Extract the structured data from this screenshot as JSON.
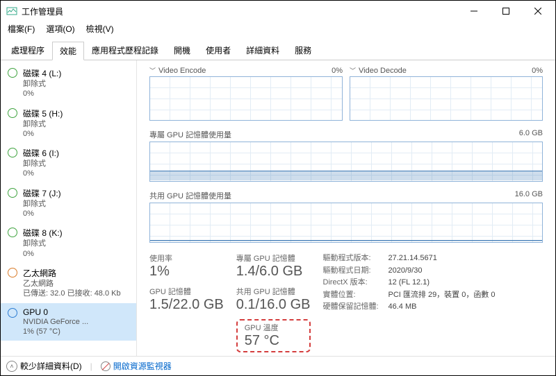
{
  "window": {
    "title": "工作管理員"
  },
  "menu": {
    "file": "檔案(F)",
    "options": "選項(O)",
    "view": "檢視(V)"
  },
  "tabs": {
    "processes": "處理程序",
    "performance": "效能",
    "app_history": "應用程式歷程記錄",
    "startup": "開機",
    "users": "使用者",
    "details": "詳細資料",
    "services": "服務"
  },
  "sidebar": [
    {
      "name": "磁碟 4 (L:)",
      "sub1": "卸除式",
      "sub2": "0%"
    },
    {
      "name": "磁碟 5 (H:)",
      "sub1": "卸除式",
      "sub2": "0%"
    },
    {
      "name": "磁碟 6 (I:)",
      "sub1": "卸除式",
      "sub2": "0%"
    },
    {
      "name": "磁碟 7 (J:)",
      "sub1": "卸除式",
      "sub2": "0%"
    },
    {
      "name": "磁碟 8 (K:)",
      "sub1": "卸除式",
      "sub2": "0%"
    },
    {
      "name": "乙太網路",
      "sub1": "乙太網路",
      "sub2": "已傳送: 32.0  已接收: 48.0 Kb"
    },
    {
      "name": "GPU 0",
      "sub1": "NVIDIA GeForce ...",
      "sub2": "1%  (57 °C)"
    }
  ],
  "charts": {
    "video_encode": {
      "title": "Video Encode",
      "pct": "0%"
    },
    "video_decode": {
      "title": "Video Decode",
      "pct": "0%"
    },
    "dedicated_mem": {
      "title": "專屬 GPU 記憶體使用量",
      "max": "6.0 GB"
    },
    "shared_mem": {
      "title": "共用 GPU 記憶體使用量",
      "max": "16.0 GB"
    }
  },
  "stats": {
    "usage_label": "使用率",
    "usage_value": "1%",
    "gpu_mem_label": "GPU 記憶體",
    "gpu_mem_value": "1.5/22.0 GB",
    "dedicated_label": "專屬 GPU 記憶體",
    "dedicated_value": "1.4/6.0 GB",
    "shared_label": "共用 GPU 記憶體",
    "shared_value": "0.1/16.0 GB",
    "temp_label": "GPU 溫度",
    "temp_value": "57 °C"
  },
  "info": {
    "driver_version_k": "驅動程式版本:",
    "driver_version_v": "27.21.14.5671",
    "driver_date_k": "驅動程式日期:",
    "driver_date_v": "2020/9/30",
    "directx_k": "DirectX 版本:",
    "directx_v": "12 (FL 12.1)",
    "location_k": "實體位置:",
    "location_v": "PCI 匯流排 29，裝置 0，函數 0",
    "reserved_k": "硬體保留記憶體:",
    "reserved_v": "46.4 MB"
  },
  "footer": {
    "fewer_details": "較少詳細資料(D)",
    "open_resmon": "開啟資源監視器"
  },
  "chart_data": [
    {
      "type": "line",
      "title": "Video Encode",
      "ylim": [
        0,
        100
      ],
      "values": [
        0,
        0,
        0,
        0,
        0,
        0,
        0,
        0,
        0,
        0
      ]
    },
    {
      "type": "line",
      "title": "Video Decode",
      "ylim": [
        0,
        100
      ],
      "values": [
        0,
        0,
        0,
        0,
        0,
        0,
        0,
        0,
        0,
        0
      ]
    },
    {
      "type": "area",
      "title": "專屬 GPU 記憶體使用量",
      "ylabel": "GB",
      "ylim": [
        0,
        6.0
      ],
      "values": [
        1.4,
        1.4,
        1.4,
        1.4,
        1.4,
        1.4,
        1.4,
        1.4,
        1.4,
        1.4
      ]
    },
    {
      "type": "area",
      "title": "共用 GPU 記憶體使用量",
      "ylabel": "GB",
      "ylim": [
        0,
        16.0
      ],
      "values": [
        0.1,
        0.1,
        0.1,
        0.1,
        0.1,
        0.1,
        0.1,
        0.1,
        0.1,
        0.1
      ]
    }
  ]
}
